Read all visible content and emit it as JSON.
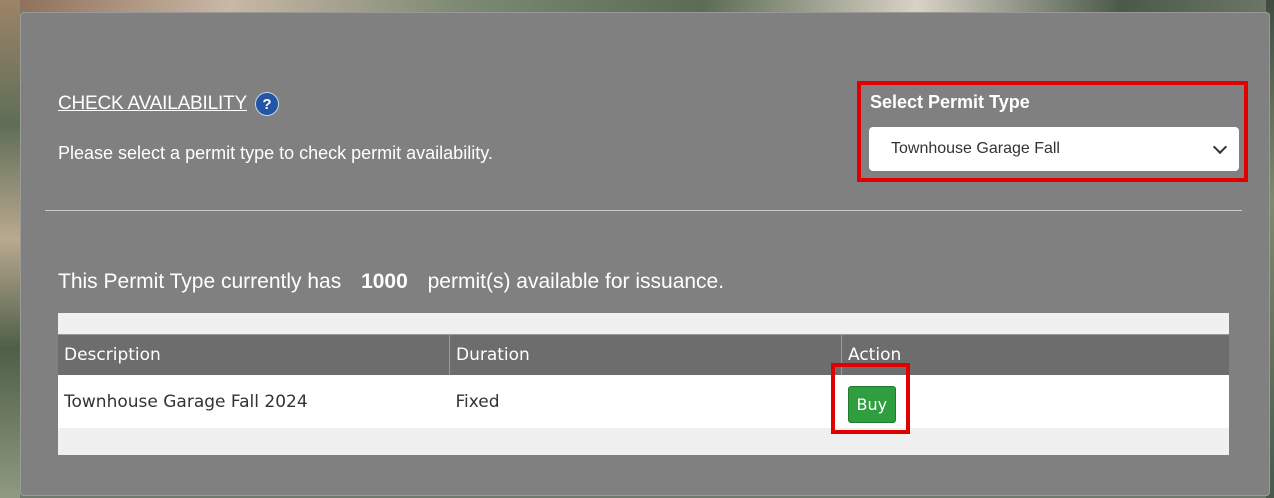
{
  "header": {
    "check_availability": "CHECK AVAILABILITY",
    "help_icon_glyph": "?",
    "instruction": "Please select a permit type to check permit availability."
  },
  "permit_select": {
    "label": "Select Permit Type",
    "selected_value": "Townhouse Garage Fall"
  },
  "availability": {
    "prefix": "This Permit Type currently has",
    "count": "1000",
    "suffix": "permit(s) available for issuance."
  },
  "table": {
    "headers": [
      "Description",
      "Duration",
      "Action"
    ],
    "rows": [
      {
        "description": "Townhouse Garage Fall 2024",
        "duration": "Fixed",
        "action_label": "Buy"
      }
    ]
  },
  "icons": {
    "help": "question-circle-icon",
    "dropdown": "chevron-down-icon"
  },
  "colors": {
    "panel_bg": "#808080",
    "help_icon_bg": "#2255a4",
    "buy_button": "#2e9e3e",
    "highlight_box": "#e00000"
  }
}
